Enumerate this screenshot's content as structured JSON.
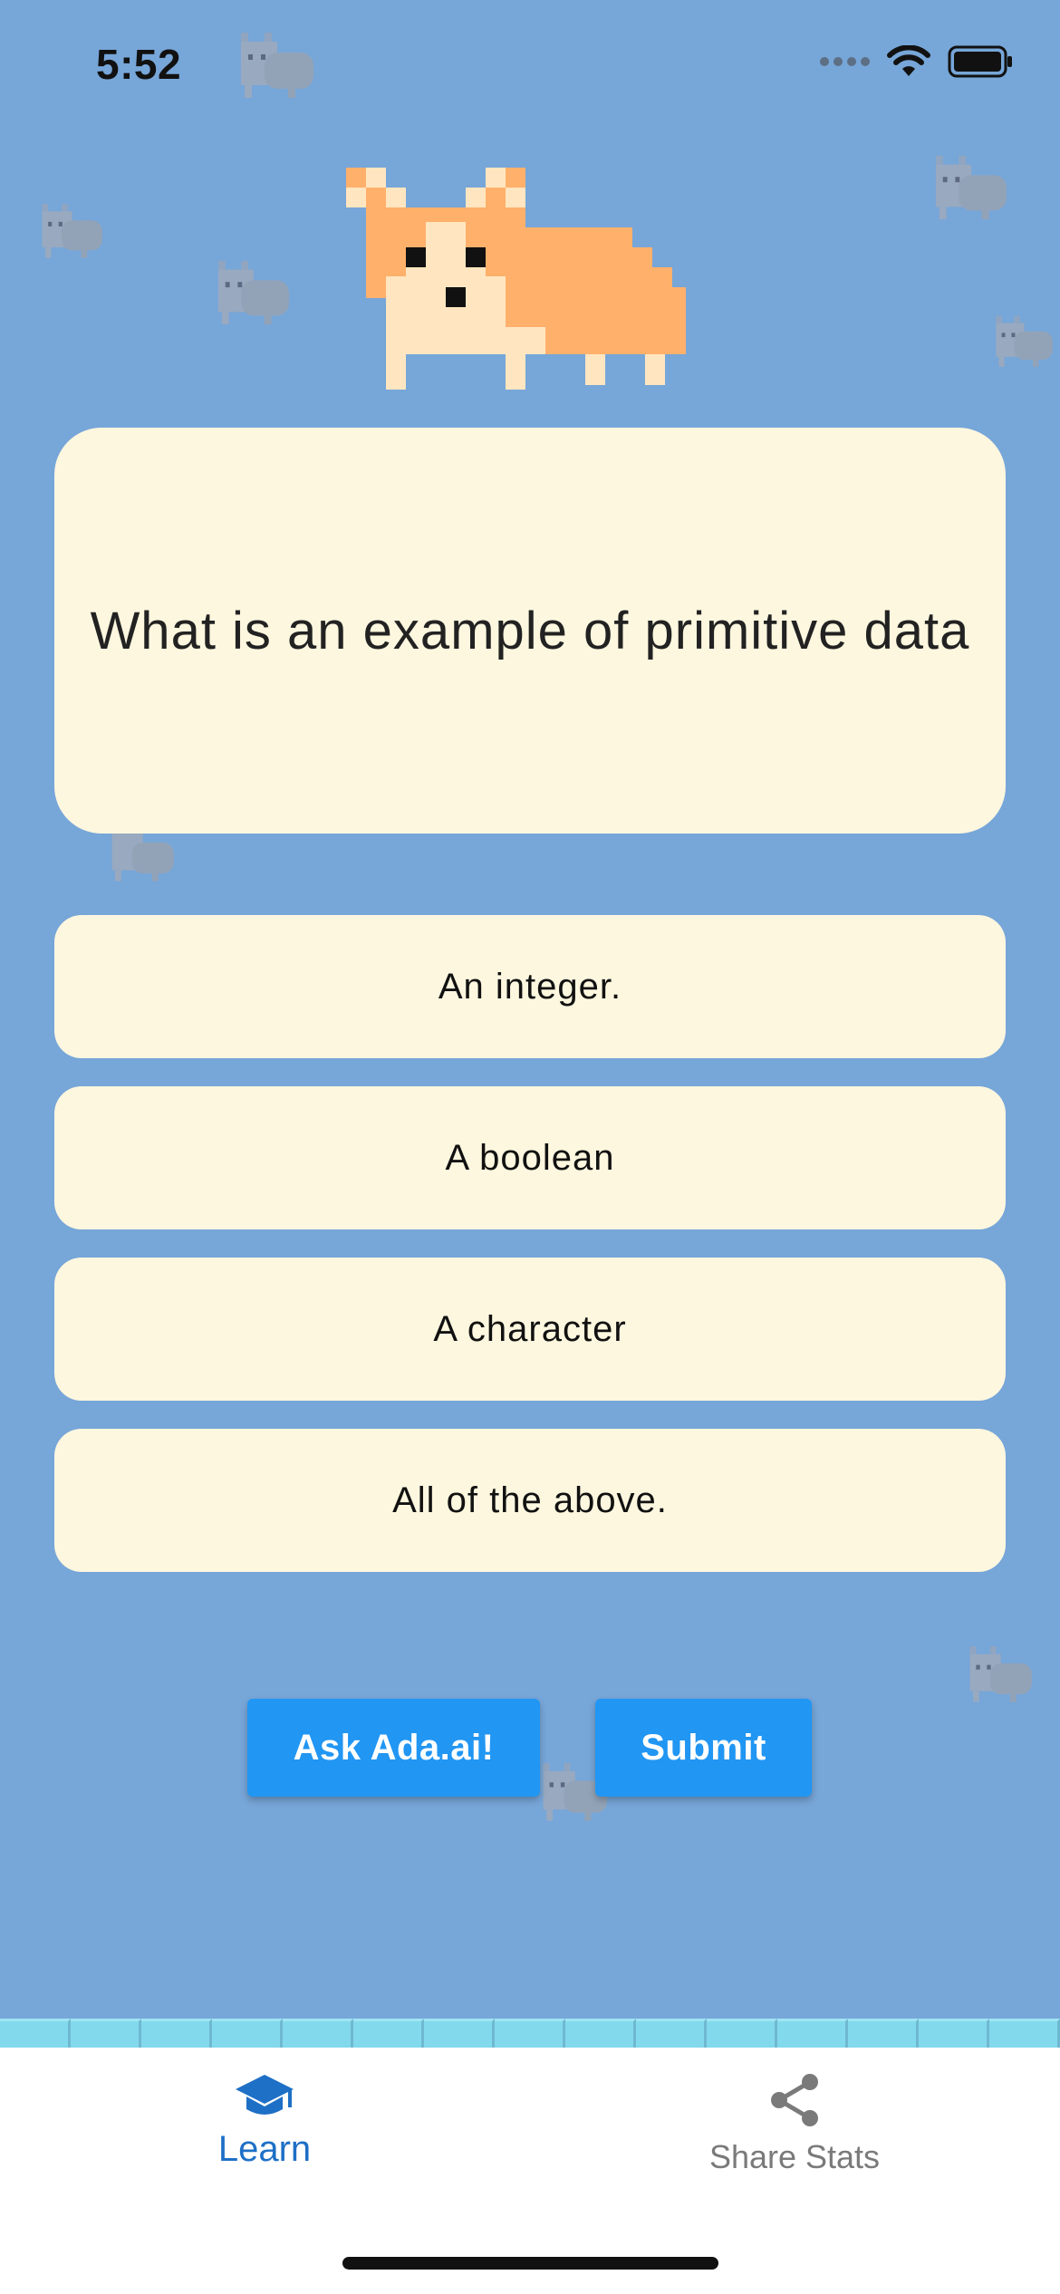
{
  "status_bar": {
    "time": "5:52"
  },
  "question": {
    "text": "What is an example of primitive data"
  },
  "answers": [
    "An integer.",
    "A boolean",
    "A character",
    "All of the above."
  ],
  "actions": {
    "ask_label": "Ask Ada.ai!",
    "submit_label": "Submit"
  },
  "tab_bar": {
    "learn_label": "Learn",
    "share_label": "Share Stats",
    "active_tab": "Learn"
  },
  "colors": {
    "background": "#77a6d8",
    "card": "#fdf7df",
    "button": "#2196f3",
    "active_tab": "#1e6fc6",
    "inactive_tab": "#7a7a7a",
    "corgi_orange": "#ffb06b",
    "corgi_cream": "#ffe6c0"
  },
  "icons": {
    "learn": "graduation-cap-icon",
    "share": "share-icon",
    "mascot": "pixel-corgi"
  }
}
